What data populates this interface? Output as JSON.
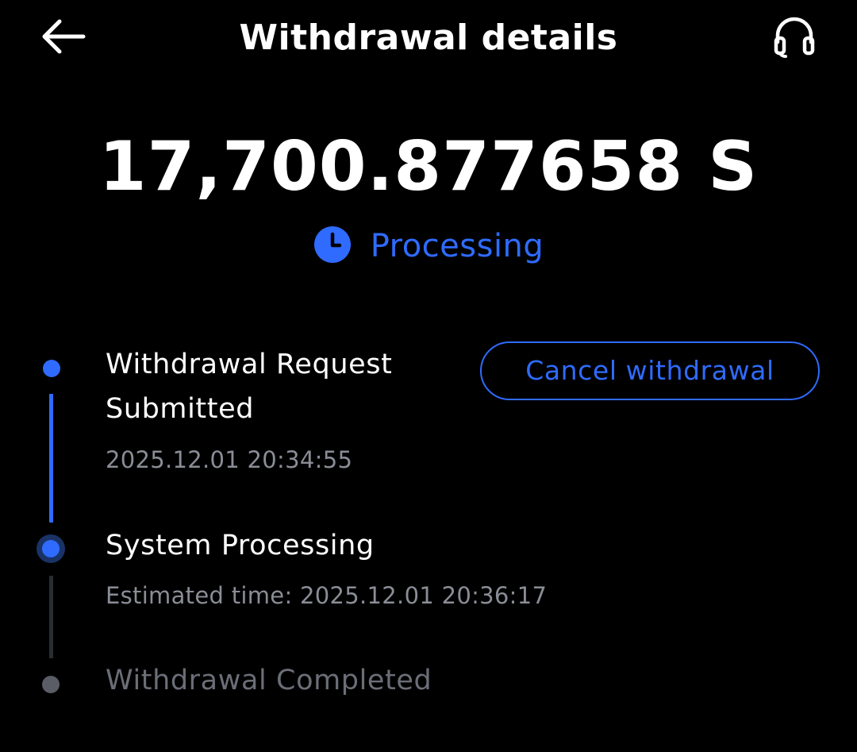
{
  "header": {
    "title": "Withdrawal details",
    "back_icon": "arrow-left-icon",
    "support_icon": "headset-icon"
  },
  "amount": {
    "value": "17,700.877658 S"
  },
  "status": {
    "label": "Processing",
    "icon": "clock-icon"
  },
  "timeline": {
    "steps": [
      {
        "title_line1": "Withdrawal Request",
        "title_line2": "Submitted",
        "timestamp": "2025.12.01 20:34:55",
        "state": "done"
      },
      {
        "title": "System Processing",
        "subtitle": "Estimated time: 2025.12.01 20:36:17",
        "state": "current"
      },
      {
        "title": "Withdrawal Completed",
        "state": "pending"
      }
    ]
  },
  "actions": {
    "cancel_label": "Cancel withdrawal"
  },
  "colors": {
    "background": "#000000",
    "text_primary": "#ffffff",
    "accent": "#2f6bff",
    "text_muted": "#8a8d96",
    "text_disabled": "#6b6e77",
    "line_inactive": "#2a2c33",
    "dot_inactive": "#5a5d66"
  }
}
